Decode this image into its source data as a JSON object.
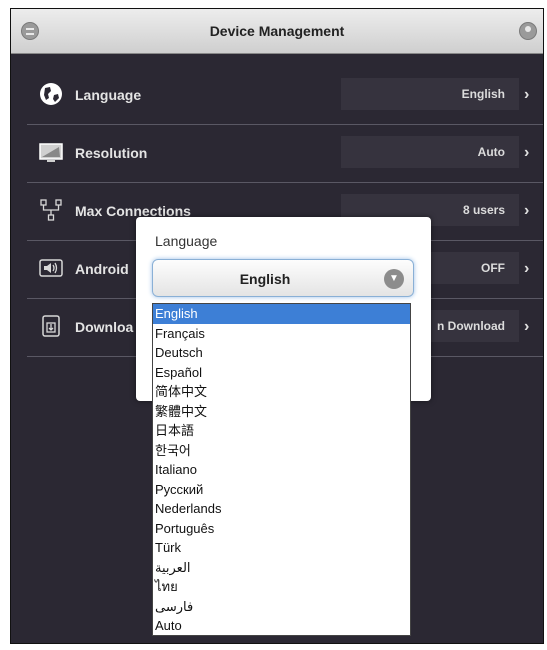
{
  "header": {
    "title": "Device Management",
    "left_icon": "menu-icon",
    "right_icon": "user-icon"
  },
  "settings": [
    {
      "label": "Language",
      "value": "English",
      "icon": "globe-icon"
    },
    {
      "label": "Resolution",
      "value": "Auto",
      "icon": "monitor-icon"
    },
    {
      "label": "Max Connections",
      "value": "8 users",
      "icon": "network-icon"
    },
    {
      "label": "Android",
      "value": "OFF",
      "icon": "audio-icon"
    },
    {
      "label": "Downloa",
      "value": "n Download",
      "icon": "download-icon"
    }
  ],
  "dialog": {
    "label": "Language",
    "selected_value": "English",
    "options": [
      "English",
      "Français",
      "Deutsch",
      "Español",
      "简体中文",
      "繁體中文",
      "日本語",
      "한국어",
      "Italiano",
      "Русский",
      "Nederlands",
      "Português",
      "Türk",
      "العربية",
      "ไทย",
      "فارسی",
      "Auto"
    ]
  },
  "colors": {
    "background": "#2b2833",
    "highlight": "#3d7fd6"
  }
}
